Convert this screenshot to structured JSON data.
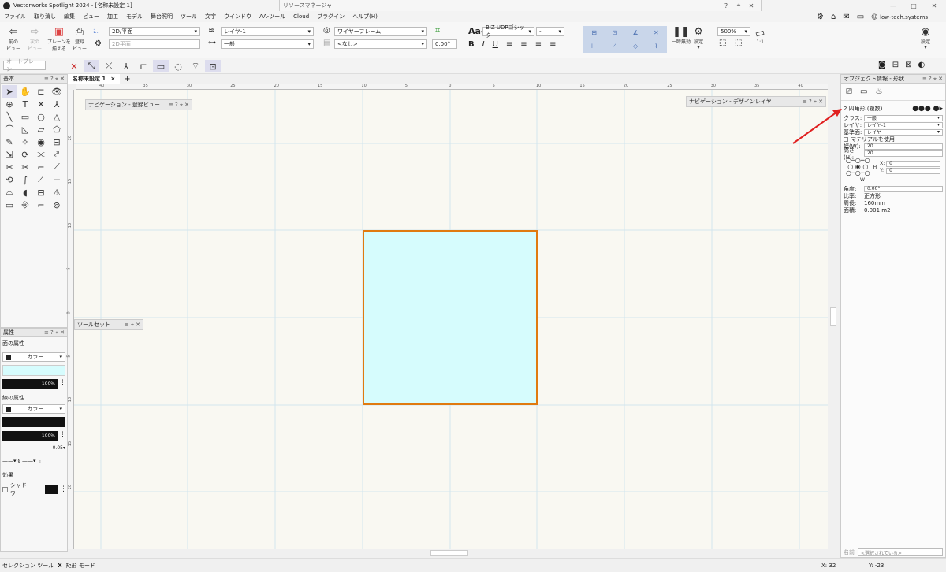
{
  "app": {
    "title": "Vectorworks Spotlight 2024 - [名称未設定 1]",
    "center_title": "リソースマネージャ",
    "user": "low-tech.systems",
    "controls": {
      "help": "?",
      "pin": "⌖",
      "minimize": "—",
      "maximize": "□",
      "close": "✕"
    }
  },
  "menu": [
    "ファイル",
    "取り消し",
    "編集",
    "ビュー",
    "加工",
    "モデル",
    "舞台照明",
    "ツール",
    "文字",
    "ウインドウ",
    "AA-ツール",
    "Cloud",
    "プラグイン",
    "ヘルプ(H)"
  ],
  "toolbar": {
    "prev_view": "前の\nビュー",
    "next_view": "次の\nビュー",
    "plane_align": "プレーンを\n揃える",
    "registered_view": "登録\nビュー",
    "view_select": "2D/平面",
    "plane_select": "2D平面",
    "layer_select": "レイヤ-1",
    "class_select": "一般",
    "render_select": "ワイヤーフレーム",
    "render_sub": "<なし>",
    "angle": "0.00°",
    "font_name": "BIZ UDPゴシック",
    "font_size": "-",
    "bold": "B",
    "italic": "I",
    "underline": "U",
    "pause_label": "一時無効",
    "settings_label": "設定",
    "zoom": "500%",
    "scale": "1:1",
    "right_settings": "設定"
  },
  "subbar": {
    "auto_plane": "オートプレーン"
  },
  "doc_tab": {
    "name": "名称未設定 1"
  },
  "basic_palette": {
    "title": "基本"
  },
  "attributes": {
    "title": "属性",
    "fill_label": "面の属性",
    "fill_type": "カラー",
    "fill_opacity": "100%",
    "line_label": "線の属性",
    "line_type": "カラー",
    "line_opacity": "100%",
    "line_weight": "0.05",
    "effects_label": "効果",
    "shadow_label": "シャドウ"
  },
  "nav_registered": {
    "title": "ナビゲーション - 登録ビュー"
  },
  "nav_design": {
    "title": "ナビゲーション - デザインレイヤ"
  },
  "toolset": {
    "title": "ツールセット"
  },
  "oip": {
    "title": "オブジェクト情報 - 形状",
    "object_type": "2 四角形 (複数)",
    "class_label": "クラス:",
    "class_value": "一般",
    "layer_label": "レイヤ:",
    "layer_value": "レイヤ-1",
    "base_label": "基準面:",
    "base_value": "レイヤ",
    "material_label": "マテリアルを使用",
    "width_label": "幅(W):",
    "width_value": "20",
    "height_label": "高さ(H):",
    "height_value": "20",
    "x_label": "X:",
    "x_value": "0",
    "y_label": "Y:",
    "y_value": "0",
    "h_label": "H",
    "w_label": "W",
    "angle_label": "角度:",
    "angle_value": "0.00°",
    "ratio_label": "比率:",
    "ratio_value": "正方形",
    "perimeter_label": "周長:",
    "perimeter_value": "160mm",
    "area_label": "面積:",
    "area_value": "0.001 m2",
    "name_label": "名前",
    "name_placeholder": "<選択されている>"
  },
  "ruler_top": [
    "40",
    "35",
    "30",
    "25",
    "20",
    "15",
    "10",
    "5",
    "0",
    "5",
    "10",
    "15",
    "20",
    "25",
    "30",
    "35",
    "40"
  ],
  "ruler_left": [
    "20",
    "15",
    "10",
    "5",
    "0",
    "5",
    "10",
    "15",
    "20"
  ],
  "status": {
    "left": "セレクション ツール",
    "mode_x": "X",
    "mode": "矩形 モード",
    "x": "X: 32",
    "y": "Y: -23"
  },
  "colors": {
    "shape_fill": "#d6fcfd",
    "shape_stroke": "#e07a10",
    "canvas": "#f9f8f2",
    "grid": "#d2e6ee",
    "arrow": "#e02020"
  }
}
